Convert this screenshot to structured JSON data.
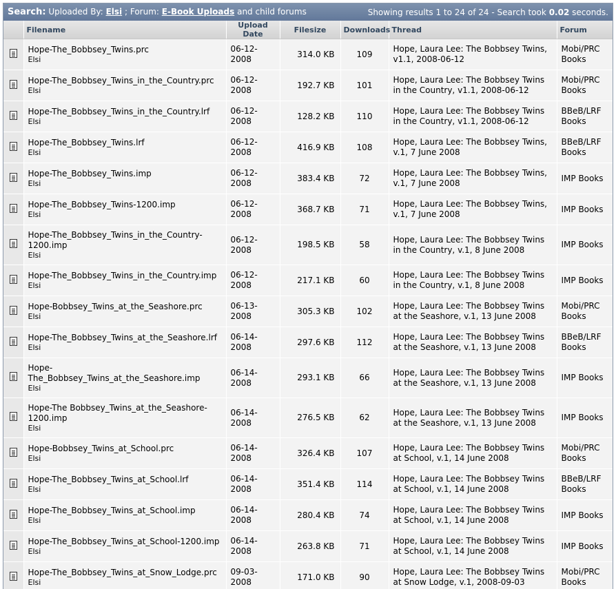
{
  "search": {
    "label": "Search:",
    "uploaded_by_text": "Uploaded By:",
    "user": "Elsi",
    "sep": ";",
    "forum_text": "Forum:",
    "forum_link": "E-Book Uploads",
    "child_text": "and child forums",
    "results_prefix": "Showing results 1 to 24 of 24 - Search took",
    "time": "0.02",
    "results_suffix": "seconds."
  },
  "columns": {
    "filename": "Filename",
    "date": "Upload Date",
    "size": "Filesize",
    "downloads": "Downloads",
    "thread": "Thread",
    "forum": "Forum"
  },
  "colors": {
    "header_bar": "#6b7f9b",
    "column_head": "#dcdcdc",
    "row_bg": "#f3f3f3"
  },
  "rows": [
    {
      "file": "Hope-The_Bobbsey_Twins.prc",
      "user": "Elsi",
      "date": "06-12-2008",
      "size": "314.0 KB",
      "dl": "109",
      "thread": "Hope, Laura Lee: The Bobbsey Twins, v1.1, 2008-06-12",
      "forum": "Mobi/PRC Books"
    },
    {
      "file": "Hope-The_Bobbsey_Twins_in_the_Country.prc",
      "user": "Elsi",
      "date": "06-12-2008",
      "size": "192.7 KB",
      "dl": "101",
      "thread": "Hope, Laura Lee: The Bobbsey Twins in the Country, v1.1, 2008-06-12",
      "forum": "Mobi/PRC Books"
    },
    {
      "file": "Hope-The_Bobbsey_Twins_in_the_Country.lrf",
      "user": "Elsi",
      "date": "06-12-2008",
      "size": "128.2 KB",
      "dl": "110",
      "thread": "Hope, Laura Lee: The Bobbsey Twins in the Country, v1.1, 2008-06-12",
      "forum": "BBeB/LRF Books"
    },
    {
      "file": "Hope-The_Bobbsey_Twins.lrf",
      "user": "Elsi",
      "date": "06-12-2008",
      "size": "416.9 KB",
      "dl": "108",
      "thread": "Hope, Laura Lee: The Bobbsey Twins, v.1, 7 June 2008",
      "forum": "BBeB/LRF Books"
    },
    {
      "file": "Hope-The_Bobbsey_Twins.imp",
      "user": "Elsi",
      "date": "06-12-2008",
      "size": "383.4 KB",
      "dl": "72",
      "thread": "Hope, Laura Lee: The Bobbsey Twins, v.1, 7 June 2008",
      "forum": "IMP Books"
    },
    {
      "file": "Hope-The_Bobbsey_Twins-1200.imp",
      "user": "Elsi",
      "date": "06-12-2008",
      "size": "368.7 KB",
      "dl": "71",
      "thread": "Hope, Laura Lee: The Bobbsey Twins, v.1, 7 June 2008",
      "forum": "IMP Books"
    },
    {
      "file": "Hope-The_Bobbsey_Twins_in_the_Country-1200.imp",
      "user": "Elsi",
      "date": "06-12-2008",
      "size": "198.5 KB",
      "dl": "58",
      "thread": "Hope, Laura Lee: The Bobbsey Twins in the Country, v.1, 8 June 2008",
      "forum": "IMP Books"
    },
    {
      "file": "Hope-The_Bobbsey_Twins_in_the_Country.imp",
      "user": "Elsi",
      "date": "06-12-2008",
      "size": "217.1 KB",
      "dl": "60",
      "thread": "Hope, Laura Lee: The Bobbsey Twins in the Country, v.1, 8 June 2008",
      "forum": "IMP Books"
    },
    {
      "file": "Hope-Bobbsey_Twins_at_the_Seashore.prc",
      "user": "Elsi",
      "date": "06-13-2008",
      "size": "305.3 KB",
      "dl": "102",
      "thread": "Hope, Laura Lee: The Bobbsey Twins at the Seashore, v.1, 13 June 2008",
      "forum": "Mobi/PRC Books"
    },
    {
      "file": "Hope-The_Bobbsey_Twins_at_the_Seashore.lrf",
      "user": "Elsi",
      "date": "06-14-2008",
      "size": "297.6 KB",
      "dl": "112",
      "thread": "Hope, Laura Lee: The Bobbsey Twins at the Seashore, v.1, 13 June 2008",
      "forum": "BBeB/LRF Books"
    },
    {
      "file": "Hope-The_Bobbsey_Twins_at_the_Seashore.imp",
      "user": "Elsi",
      "date": "06-14-2008",
      "size": "293.1 KB",
      "dl": "66",
      "thread": "Hope, Laura Lee: The Bobbsey Twins at the Seashore, v.1, 13 June 2008",
      "forum": "IMP Books"
    },
    {
      "file": "Hope-The Bobbsey_Twins_at_the_Seashore-1200.imp",
      "user": "Elsi",
      "date": "06-14-2008",
      "size": "276.5 KB",
      "dl": "62",
      "thread": "Hope, Laura Lee: The Bobbsey Twins at the Seashore, v.1, 13 June 2008",
      "forum": "IMP Books"
    },
    {
      "file": "Hope-Bobbsey_Twins_at_School.prc",
      "user": "Elsi",
      "date": "06-14-2008",
      "size": "326.4 KB",
      "dl": "107",
      "thread": "Hope, Laura Lee: The Bobbsey Twins at School, v.1, 14 June 2008",
      "forum": "Mobi/PRC Books"
    },
    {
      "file": "Hope-The_Bobbsey_Twins_at_School.lrf",
      "user": "Elsi",
      "date": "06-14-2008",
      "size": "351.4 KB",
      "dl": "114",
      "thread": "Hope, Laura Lee: The Bobbsey Twins at School, v.1, 14 June 2008",
      "forum": "BBeB/LRF Books"
    },
    {
      "file": "Hope-The_Bobbsey_Twins_at_School.imp",
      "user": "Elsi",
      "date": "06-14-2008",
      "size": "280.4 KB",
      "dl": "74",
      "thread": "Hope, Laura Lee: The Bobbsey Twins at School, v.1, 14 June 2008",
      "forum": "IMP Books"
    },
    {
      "file": "Hope-The_Bobbsey_Twins_at_School-1200.imp",
      "user": "Elsi",
      "date": "06-14-2008",
      "size": "263.8 KB",
      "dl": "71",
      "thread": "Hope, Laura Lee: The Bobbsey Twins at School, v.1, 14 June 2008",
      "forum": "IMP Books"
    },
    {
      "file": "Hope-The_Bobbsey_Twins_at_Snow_Lodge.prc",
      "user": "Elsi",
      "date": "09-03-2008",
      "size": "171.0 KB",
      "dl": "90",
      "thread": "Hope, Laura Lee: The Bobbsey Twins at Snow Lodge, v.1, 2008-09-03",
      "forum": "Mobi/PRC Books"
    }
  ]
}
